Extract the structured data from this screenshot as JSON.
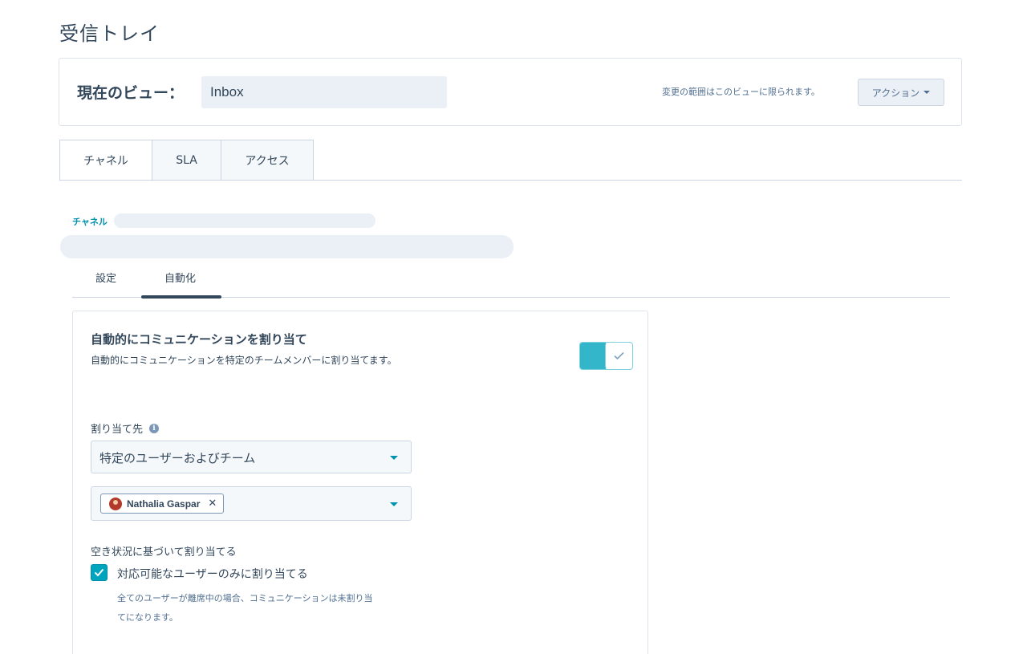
{
  "page": {
    "title": "受信トレイ"
  },
  "view": {
    "label": "現在のビュー：",
    "input_value": "Inbox",
    "scope_note": "変更の範囲はこのビューに限られます。",
    "action_label": "アクション"
  },
  "tabs": [
    {
      "label": "チャネル",
      "active": true
    },
    {
      "label": "SLA",
      "active": false
    },
    {
      "label": "アクセス",
      "active": false
    }
  ],
  "breadcrumb": {
    "label": "チャネル"
  },
  "subtabs": [
    {
      "label": "設定",
      "active": false
    },
    {
      "label": "自動化",
      "active": true
    }
  ],
  "automation": {
    "title": "自動的にコミュニケーションを割り当て",
    "description": "自動的にコミュニケーションを特定のチームメンバーに割り当てます。",
    "toggle_on": true,
    "assign_label": "割り当て先",
    "assign_select_value": "特定のユーザーおよびチーム",
    "assignees": [
      "Nathalia Gaspar"
    ],
    "availability_label": "空き状況に基づいて割り当てる",
    "checkbox_label": "対応可能なユーザーのみに割り当てる",
    "checkbox_checked": true,
    "help_text_line1": "全てのユーザーが離席中の場合、コミュニケーションは未割り当",
    "help_text_line2": "てになります。"
  },
  "colors": {
    "accent": "#00a4bd",
    "text": "#33475b",
    "link": "#0091ae",
    "border": "#cbd6e2",
    "skeleton": "#eaf0f6"
  }
}
